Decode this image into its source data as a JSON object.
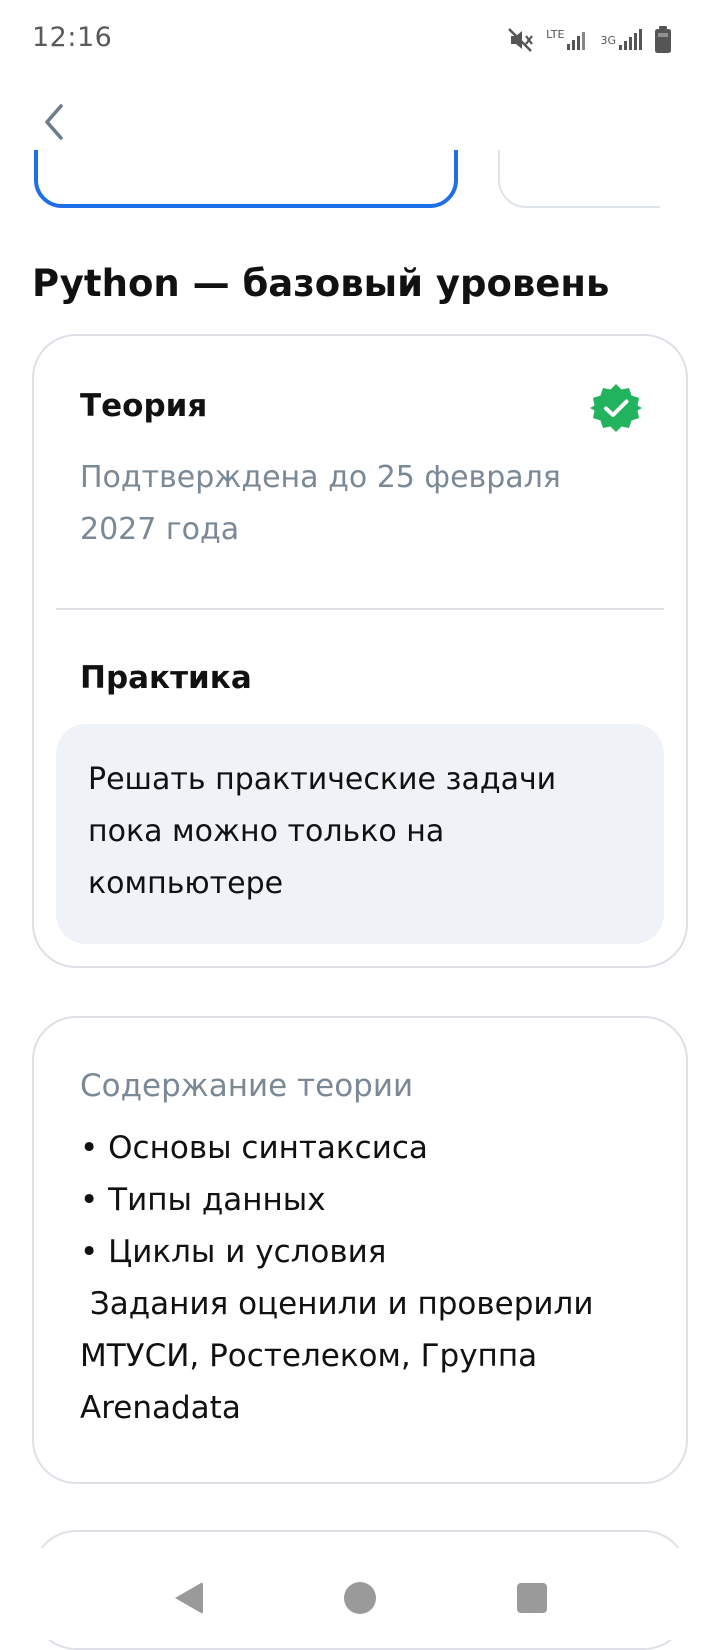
{
  "status_bar": {
    "time": "12:16",
    "icons": [
      "mute-icon",
      "lte-signal-icon",
      "3g-signal-icon",
      "battery-icon"
    ],
    "lte_label": "LTE",
    "threeg_label": "3G"
  },
  "app_bar": {
    "back_icon": "chevron-left-icon"
  },
  "course": {
    "title": "Python — базовый уровень"
  },
  "card_status": {
    "theory_title": "Теория",
    "theory_status": "Подтверждена до 25 февраля 2027 года",
    "verified_icon": "verified-badge-icon",
    "verified_color": "#22b35e",
    "practice_title": "Практика",
    "practice_note": "Решать практические задачи пока можно только на компьютере"
  },
  "card_contents": {
    "title": "Содержание теории",
    "items": [
      "• Основы синтаксиса",
      "• Типы данных",
      "• Циклы и условия"
    ],
    "note": " Задания оценили и проверили МТУСИ, Ростелеком, Группа Arenadata"
  },
  "colors": {
    "accent": "#1f6fe8",
    "muted_text": "#7b8896",
    "border": "#dde1e7",
    "note_background": "#eff2f7"
  },
  "nav_bar": {
    "icons": [
      "nav-back-icon",
      "nav-home-icon",
      "nav-recents-icon"
    ]
  }
}
